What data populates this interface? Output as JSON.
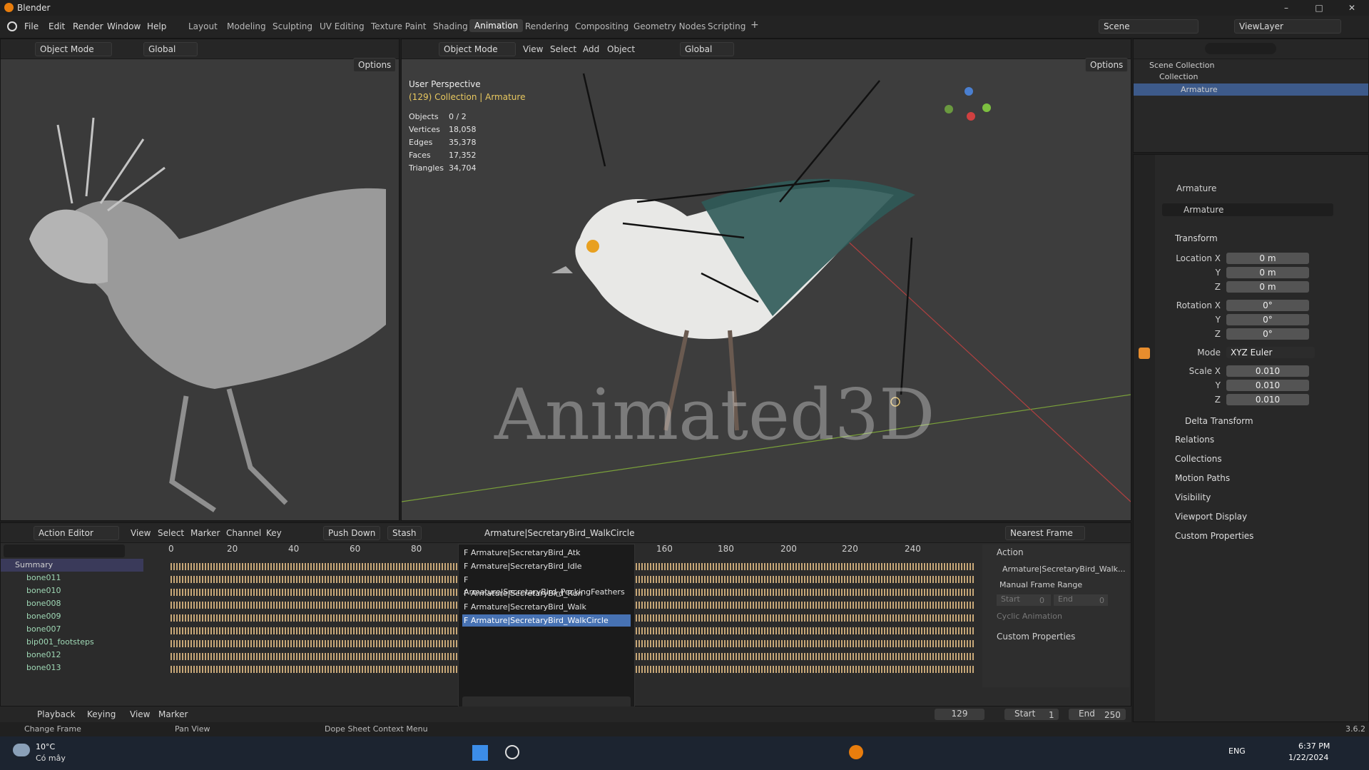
{
  "window": {
    "title": "Blender",
    "minimize": "–",
    "maximize": "□",
    "close": "✕"
  },
  "menus": [
    "File",
    "Edit",
    "Render",
    "Window",
    "Help"
  ],
  "workspaces": [
    "Layout",
    "Modeling",
    "Sculpting",
    "UV Editing",
    "Texture Paint",
    "Shading",
    "Animation",
    "Rendering",
    "Compositing",
    "Geometry Nodes",
    "Scripting"
  ],
  "workspace_active": "Animation",
  "workspace_add": "+",
  "scene": {
    "label": "Scene",
    "view_layer": "ViewLayer"
  },
  "left_viewport": {
    "mode": "Object Mode",
    "orientation": "Global",
    "options": "Options"
  },
  "main_viewport": {
    "mode": "Object Mode",
    "menus": [
      "View",
      "Select",
      "Add",
      "Object"
    ],
    "orientation": "Global",
    "options": "Options",
    "perspective": "User Perspective",
    "collection_info": "(129) Collection | Armature",
    "stats": [
      {
        "label": "Objects",
        "value": "0 / 2"
      },
      {
        "label": "Vertices",
        "value": "18,058"
      },
      {
        "label": "Edges",
        "value": "35,378"
      },
      {
        "label": "Faces",
        "value": "17,352"
      },
      {
        "label": "Triangles",
        "value": "34,704"
      }
    ],
    "watermark": "Animated3D"
  },
  "outliner": {
    "items": [
      {
        "label": "Scene Collection"
      },
      {
        "label": "Collection"
      },
      {
        "label": "Armature"
      }
    ]
  },
  "properties": {
    "object_name": "Armature",
    "data_name": "Armature",
    "transform_title": "Transform",
    "location": {
      "label": "Location X",
      "x": "0 m",
      "y": "0 m",
      "z": "0 m"
    },
    "rotation": {
      "label": "Rotation X",
      "x": "0°",
      "y": "0°",
      "z": "0°"
    },
    "mode_label": "Mode",
    "mode_value": "XYZ Euler",
    "scale": {
      "label": "Scale X",
      "x": "0.010",
      "y": "0.010",
      "z": "0.010"
    },
    "axis_y": "Y",
    "axis_z": "Z",
    "sections": [
      "Delta Transform",
      "Relations",
      "Collections",
      "Motion Paths",
      "Visibility",
      "Viewport Display",
      "Custom Properties"
    ]
  },
  "action_editor": {
    "editor": "Action Editor",
    "menus": [
      "View",
      "Select",
      "Marker",
      "Channel",
      "Key"
    ],
    "push_down": "Push Down",
    "stash": "Stash",
    "action": "Armature|SecretaryBird_WalkCircle",
    "snap": "Nearest Frame",
    "summary": "Summary",
    "channels": [
      "bone011",
      "bone010",
      "bone008",
      "bone009",
      "bone007",
      "bip001_footsteps",
      "bone012",
      "bone013"
    ],
    "ticks": [
      "0",
      "20",
      "40",
      "60",
      "80",
      "160",
      "180",
      "200",
      "220",
      "240"
    ],
    "dropdown": [
      "F Armature|SecretaryBird_Atk",
      "F Armature|SecretaryBird_Idle",
      "F Armature|SecretaryBird_PeckingFeathers",
      "F Armature|SecretaryBird_Run",
      "F Armature|SecretaryBird_Walk",
      "F Armature|SecretaryBird_WalkCircle"
    ],
    "side": {
      "title": "Action",
      "action_name": "Armature|SecretaryBird_Walk...",
      "manual_range": "Manual Frame Range",
      "start_label": "Start",
      "start_value": "0",
      "end_label": "End",
      "end_value": "0",
      "cyclic": "Cyclic Animation",
      "custom": "Custom Properties"
    }
  },
  "timeline": {
    "menus": [
      "Playback",
      "Keying",
      "View",
      "Marker"
    ],
    "current_frame": "129",
    "start_label": "Start",
    "start": "1",
    "end_label": "End",
    "end": "250"
  },
  "statusbar": {
    "change_frame": "Change Frame",
    "pan_view": "Pan View",
    "context_menu": "Dope Sheet Context Menu",
    "version": "3.6.2"
  },
  "taskbar": {
    "temp": "10°C",
    "weather": "Có mây",
    "lang": "ENG",
    "time": "6:37 PM",
    "date": "1/22/2024"
  }
}
